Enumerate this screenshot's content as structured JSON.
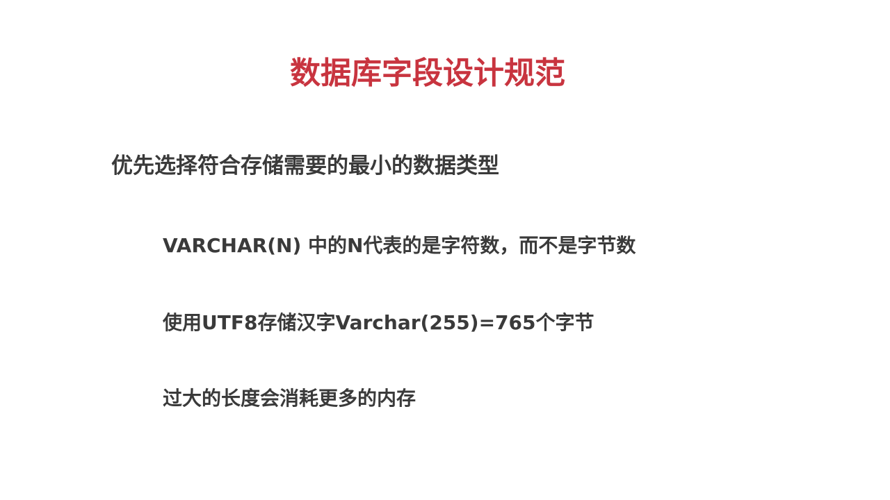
{
  "slide": {
    "title": "数据库字段设计规范",
    "main_point": "优先选择符合存储需要的最小的数据类型",
    "sub_points": [
      "VARCHAR(N) 中的N代表的是字符数，而不是字节数",
      "使用UTF8存储汉字Varchar(255)=765个字节",
      "过大的长度会消耗更多的内存"
    ]
  },
  "colors": {
    "title": "#c8343f",
    "body_text": "#3a3a3a",
    "background": "#ffffff"
  }
}
